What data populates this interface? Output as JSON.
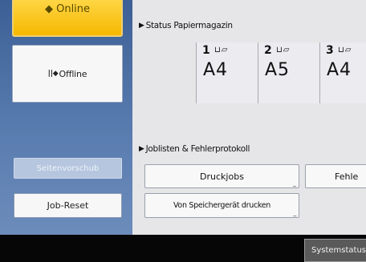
{
  "left": {
    "online_label": "Online",
    "offline_label": "Offline",
    "offline_icon": "||◆",
    "seitenvorschub_label": "Seitenvorschub",
    "jobreset_label": "Job-Reset"
  },
  "status": {
    "heading": "Status Papiermagazin",
    "trays": [
      {
        "num": "1",
        "icons": "⊔▱",
        "size": "A4"
      },
      {
        "num": "2",
        "icons": "⊔▱",
        "size": "A5"
      },
      {
        "num": "3",
        "icons": "⊔▱",
        "size": "A4"
      }
    ]
  },
  "jobs": {
    "heading": "Joblisten & Fehlerprotokoll",
    "druckjobs_label": "Druckjobs",
    "fehler_label": "Fehle",
    "speicher_label": "Von Speichergerät drucken"
  },
  "bottom": {
    "systemstatus_label": "Systemstatus"
  },
  "colors": {
    "online_yellow": "#f5b800",
    "panel_blue": "#4a6ca3",
    "right_bg": "#e6e6e8"
  }
}
